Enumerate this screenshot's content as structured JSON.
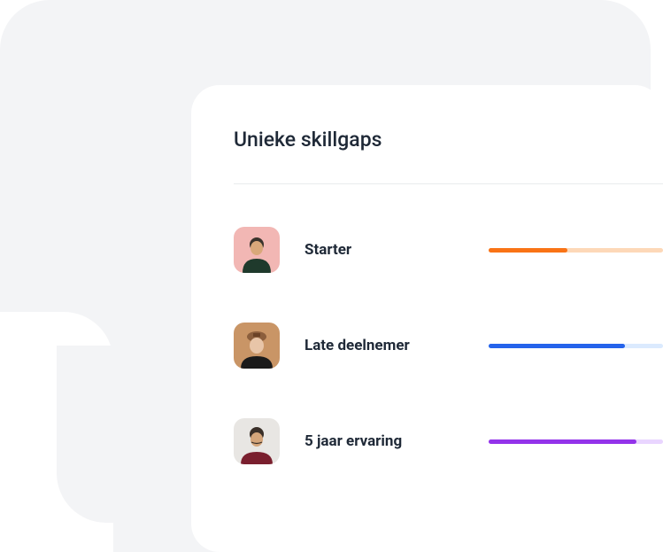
{
  "card": {
    "title": "Unieke skillgaps"
  },
  "rows": [
    {
      "label": "Starter",
      "avatar_bg": "#f2b7b4",
      "bar_color": "#f97316",
      "bar_track": "#fdd8b8",
      "progress": 45
    },
    {
      "label": "Late deelnemer",
      "avatar_bg": "#c99566",
      "bar_color": "#2563eb",
      "bar_track": "#dbeafe",
      "progress": 78
    },
    {
      "label": "5 jaar ervaring",
      "avatar_bg": "#e8e6e3",
      "bar_color": "#9333ea",
      "bar_track": "#e9d5ff",
      "progress": 85
    }
  ]
}
